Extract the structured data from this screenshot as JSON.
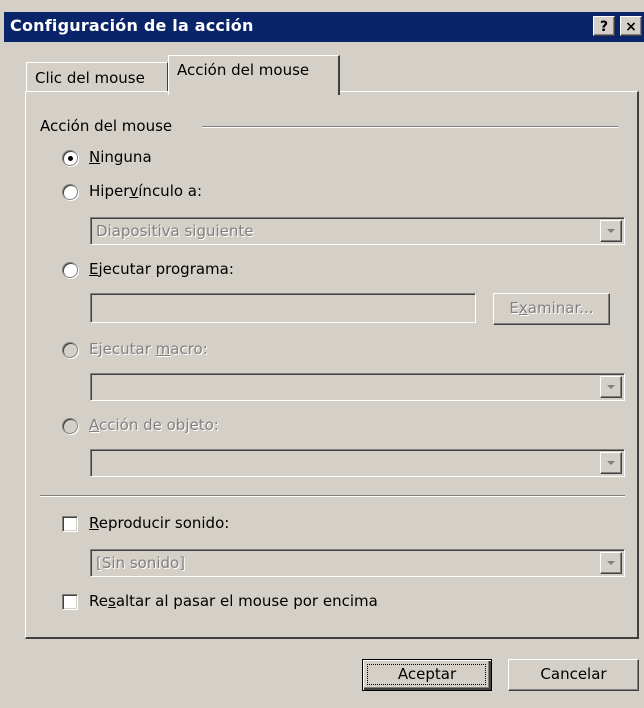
{
  "window": {
    "title": "Configuración de la acción",
    "help_label": "?",
    "close_label": "×"
  },
  "tabs": [
    {
      "label": "Clic del mouse",
      "active": false
    },
    {
      "label": "Acción del mouse",
      "active": true
    }
  ],
  "group": {
    "title": "Acción del mouse"
  },
  "options": {
    "none": {
      "pre": "",
      "key": "N",
      "post": "inguna",
      "selected": true,
      "enabled": true
    },
    "hyperlink": {
      "pre": "Hiper",
      "key": "v",
      "post": "ínculo a:",
      "selected": false,
      "enabled": true
    },
    "hyperlink_value": "Diapositiva siguiente",
    "run_program": {
      "pre": "",
      "key": "E",
      "post": "jecutar programa:",
      "selected": false,
      "enabled": true
    },
    "program_value": "",
    "browse": {
      "pre": "E",
      "key": "x",
      "post": "aminar..."
    },
    "run_macro": {
      "pre": "Ejecutar ",
      "key": "m",
      "post": "acro:",
      "selected": false,
      "enabled": false
    },
    "macro_value": "",
    "object_action": {
      "pre": "",
      "key": "A",
      "post": "cción de objeto:",
      "selected": false,
      "enabled": false
    },
    "object_value": ""
  },
  "sound": {
    "checkbox": {
      "pre": "",
      "key": "R",
      "post": "eproducir sonido:",
      "checked": false
    },
    "value": "[Sin sonido]"
  },
  "highlight": {
    "pre": "Re",
    "key": "s",
    "post": "altar al pasar el mouse por encima",
    "checked": false
  },
  "buttons": {
    "ok": "Aceptar",
    "cancel": "Cancelar"
  },
  "colors": {
    "titlebar": "#0a246a",
    "face": "#d4d0c8"
  }
}
